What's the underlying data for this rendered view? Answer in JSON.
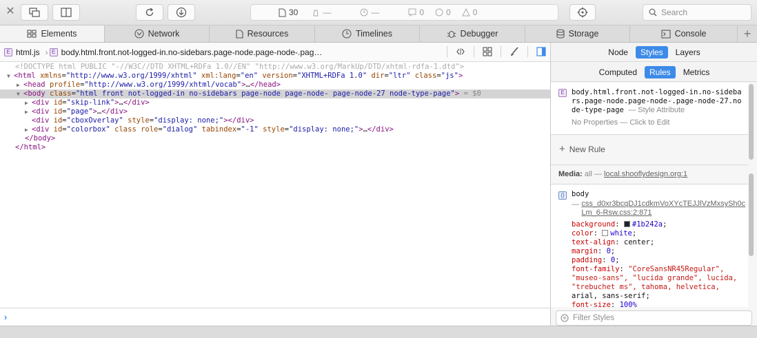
{
  "toolbar": {
    "activity": {
      "resources_count": "30",
      "load_time": "—",
      "duration": "—",
      "logs": "0",
      "errors": "0",
      "warnings": "0"
    },
    "search_placeholder": "Search"
  },
  "tabs": [
    {
      "label": "Elements",
      "icon": "elements-icon",
      "active": true
    },
    {
      "label": "Network",
      "icon": "network-icon"
    },
    {
      "label": "Resources",
      "icon": "document-icon"
    },
    {
      "label": "Timelines",
      "icon": "clock-icon"
    },
    {
      "label": "Debugger",
      "icon": "bug-icon"
    },
    {
      "label": "Storage",
      "icon": "database-icon"
    },
    {
      "label": "Console",
      "icon": "console-icon"
    }
  ],
  "breadcrumbs": {
    "first": "html.js",
    "second": "body.html.front.not-logged-in.no-sidebars.page-node.page-node-.pag…"
  },
  "dom": {
    "doctype": "<!DOCTYPE html PUBLIC \"-//W3C//DTD XHTML+RDFa 1.0//EN\" \"http://www.w3.org/MarkUp/DTD/xhtml-rdfa-1.dtd\">",
    "html_open": {
      "tag": "html",
      "attrs": [
        [
          "xmlns",
          "\"http://www.w3.org/1999/xhtml\""
        ],
        [
          "xml:lang",
          "\"en\""
        ],
        [
          "version",
          "\"XHTML+RDFa 1.0\""
        ],
        [
          "dir",
          "\"ltr\""
        ],
        [
          "class",
          "\"js\""
        ]
      ]
    },
    "head": {
      "tag": "head",
      "attrs": [
        [
          "profile",
          "\"http://www.w3.org/1999/xhtml/vocab\""
        ]
      ],
      "ellipsis": "…",
      "close": "</head>"
    },
    "body": {
      "tag": "body",
      "attrs": [
        [
          "class",
          "\"html front not-logged-in no-sidebars page-node page-node- page-node-27 node-type-page\""
        ]
      ],
      "marker": "= $0"
    },
    "div_skip": {
      "tag": "div",
      "attrs": [
        [
          "id",
          "\"skip-link\""
        ]
      ],
      "ellipsis": "…",
      "close": "</div>"
    },
    "div_page": {
      "tag": "div",
      "attrs": [
        [
          "id",
          "\"page\""
        ]
      ],
      "ellipsis": "…",
      "close": "</div>"
    },
    "div_cbox": {
      "tag": "div",
      "attrs": [
        [
          "id",
          "\"cboxOverlay\""
        ],
        [
          "style",
          "\"display: none;\""
        ]
      ],
      "close": "</div>"
    },
    "div_colorbox": {
      "tag": "div",
      "attrs": [
        [
          "id",
          "\"colorbox\""
        ],
        [
          "class",
          ""
        ],
        [
          "role",
          "\"dialog\""
        ],
        [
          "tabindex",
          "\"-1\""
        ],
        [
          "style",
          "\"display: none;\""
        ]
      ],
      "ellipsis": "…",
      "close": "</div>"
    },
    "body_close": "</body>",
    "html_close": "</html>"
  },
  "sidebar": {
    "top_segments": [
      {
        "label": "Node"
      },
      {
        "label": "Styles",
        "active": true
      },
      {
        "label": "Layers"
      }
    ],
    "sub_segments": [
      {
        "label": "Computed"
      },
      {
        "label": "Rules",
        "active": true
      },
      {
        "label": "Metrics"
      }
    ],
    "style_attr_rule": {
      "selector": "body.html.front.not-logged-in.no-sidebars.page-node.page-node-.page-node-27.node-type-page",
      "origin": "— Style Attribute",
      "empty": "No Properties — Click to Edit"
    },
    "new_rule": "New Rule",
    "media_label": "Media:",
    "media_value": "all —",
    "media_link": "local.shooflydesign.org:1",
    "body_rule": {
      "selector": "body",
      "source_link": "css_d0xr3bcqDJ1cdkmVoXYcTEJJlVzMxsySh0cLm_6-Rsw.css:2:871",
      "source_dash": "—",
      "properties": [
        {
          "name": "background",
          "value": "#1b242a",
          "swatch": "#1b242a"
        },
        {
          "name": "color",
          "value": "white",
          "swatch": "#ffffff"
        },
        {
          "name": "text-align",
          "value": "center"
        },
        {
          "name": "margin",
          "value": "0"
        },
        {
          "name": "padding",
          "value": "0"
        },
        {
          "name": "font-family",
          "value_line1": "\"CoreSansNR45Regular\",",
          "value_line2": "\"museo-sans\", \"lucida grande\", lucida,",
          "value_line3": "\"trebuchet ms\", tahoma, helvetica,",
          "value_line4": "arial, sans-serif;"
        },
        {
          "name": "font-size",
          "value": "100%"
        }
      ]
    },
    "filter_placeholder": "Filter Styles"
  }
}
